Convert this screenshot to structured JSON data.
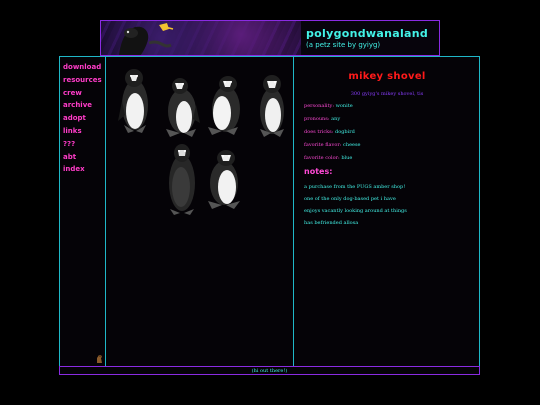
{
  "header": {
    "title": "polygondwanaland",
    "subtitle": "(a petz site by gyiyg)"
  },
  "nav": {
    "items": [
      "download",
      "resources",
      "crew",
      "archive",
      "adopt",
      "links",
      "???",
      "abt",
      "index"
    ]
  },
  "pet": {
    "name": "mikey shovel",
    "tagline": "300 gyiyg's mikey shovel, tis",
    "stats": [
      {
        "key": "personality:",
        "value": "wonite"
      },
      {
        "key": "pronouns:",
        "value": "any"
      },
      {
        "key": "does tricks:",
        "value": "dogbird"
      },
      {
        "key": "favorite flavor:",
        "value": "cheese"
      },
      {
        "key": "favorite color:",
        "value": "blue"
      }
    ]
  },
  "notes": {
    "heading": "notes:",
    "items": [
      "a purchase from the PUGS amber shop!",
      "one of the only dog-based pet i have",
      "enjoys vacantly looking around at things",
      "has befriended allosa"
    ]
  },
  "footer": {
    "text": "(hi out there!)"
  },
  "colors": {
    "accent_pink": "#ff4ad6",
    "accent_cyan": "#43f3e8",
    "name_red": "#ff1a1a",
    "border_purple": "#8a2be2"
  }
}
